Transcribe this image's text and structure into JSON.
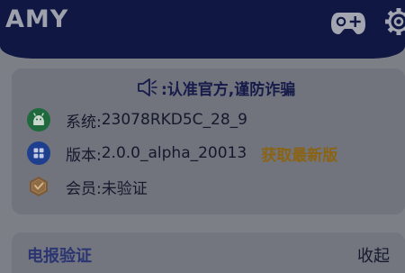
{
  "header": {
    "title": "AMY",
    "icons": [
      "gamepad-icon",
      "settings-icon"
    ]
  },
  "notice": {
    "icon": "speaker-icon",
    "text": ":认准官方,谨防诈骗"
  },
  "info": {
    "system": {
      "icon": "android-icon",
      "label": "系统:",
      "value": "23078RKD5C_28_9"
    },
    "version": {
      "icon": "grid-icon",
      "label": "版本:",
      "value": "2.0.0_alpha_20013",
      "action": "获取最新版"
    },
    "member": {
      "icon": "member-badge-icon",
      "label": "会员:",
      "value": "未验证"
    }
  },
  "verify": {
    "title": "电报验证",
    "toggle_label": "收起"
  },
  "colors": {
    "header_bg": "#0f1742",
    "overlay_bg": "#7d7f86",
    "card_bg": "#71737d",
    "accent_gold": "#8a6413",
    "accent_blue": "#2a3572"
  }
}
